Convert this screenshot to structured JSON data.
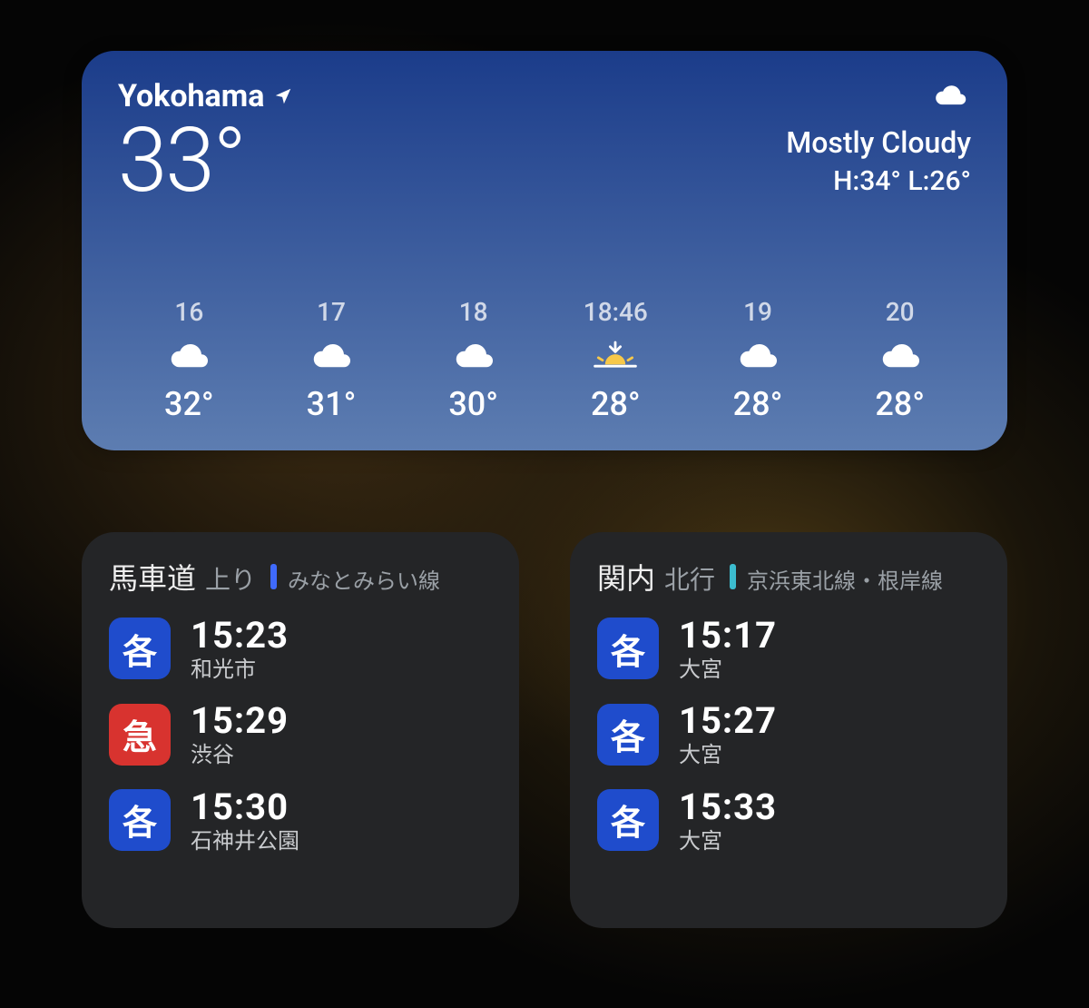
{
  "weather": {
    "location": "Yokohama",
    "location_icon": "location-arrow",
    "current_temp": "33°",
    "condition_icon": "cloud",
    "condition": "Mostly Cloudy",
    "hi_lo": "H:34° L:26°",
    "forecast": [
      {
        "time": "16",
        "icon": "cloud",
        "temp": "32°"
      },
      {
        "time": "17",
        "icon": "cloud",
        "temp": "31°"
      },
      {
        "time": "18",
        "icon": "cloud",
        "temp": "30°"
      },
      {
        "time": "18:46",
        "icon": "sunset",
        "temp": "28°"
      },
      {
        "time": "19",
        "icon": "cloud",
        "temp": "28°"
      },
      {
        "time": "20",
        "icon": "cloud",
        "temp": "28°"
      }
    ]
  },
  "transit": [
    {
      "station": "馬車道",
      "direction": "上り",
      "line_color": "blue",
      "line": "みなとみらい線",
      "departures": [
        {
          "badge": "各",
          "badge_color": "blue",
          "time": "15:23",
          "dest": "和光市"
        },
        {
          "badge": "急",
          "badge_color": "red",
          "time": "15:29",
          "dest": "渋谷"
        },
        {
          "badge": "各",
          "badge_color": "blue",
          "time": "15:30",
          "dest": "石神井公園"
        }
      ]
    },
    {
      "station": "関内",
      "direction": "北行",
      "line_color": "teal",
      "line": "京浜東北線・根岸線",
      "departures": [
        {
          "badge": "各",
          "badge_color": "blue",
          "time": "15:17",
          "dest": "大宮"
        },
        {
          "badge": "各",
          "badge_color": "blue",
          "time": "15:27",
          "dest": "大宮"
        },
        {
          "badge": "各",
          "badge_color": "blue",
          "time": "15:33",
          "dest": "大宮"
        }
      ]
    }
  ]
}
